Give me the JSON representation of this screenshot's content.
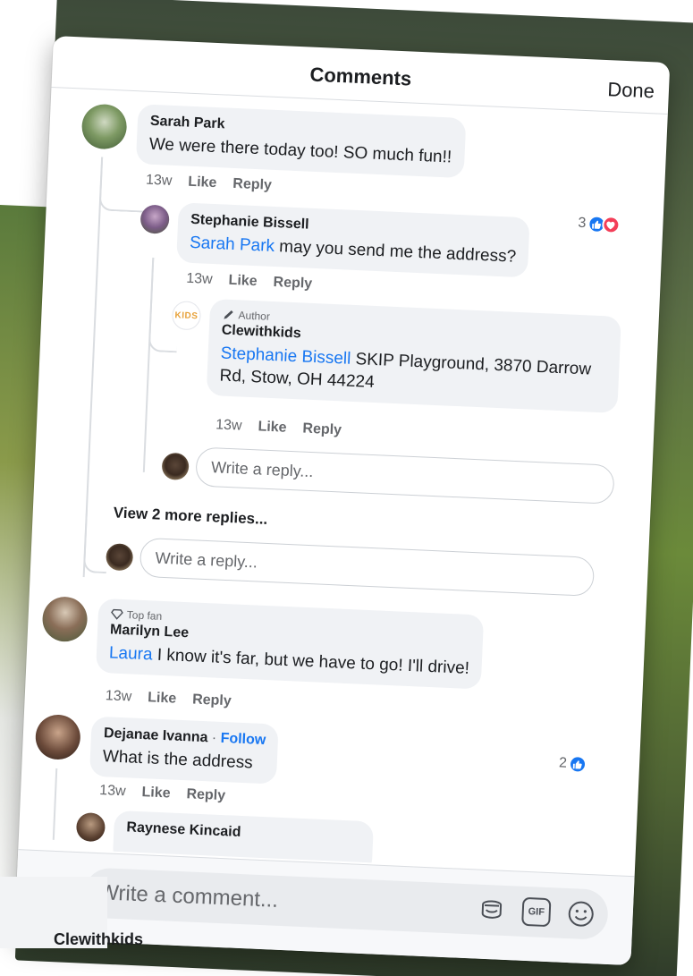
{
  "sheet": {
    "title": "Comments",
    "done_label": "Done"
  },
  "comments": [
    {
      "name": "Sarah Park",
      "text": "We were there today too!  SO much fun!!",
      "time": "13w",
      "like": "Like",
      "reply": "Reply",
      "reaction_count": "3",
      "reactions": [
        "like-icon",
        "love-icon"
      ]
    },
    {
      "name": "Stephanie Bissell",
      "mention": "Sarah Park",
      "text": " may you send me the address?",
      "time": "13w",
      "like": "Like",
      "reply": "Reply"
    },
    {
      "badge": "Author",
      "avatar_text": "KIDS",
      "name": "Clewithkids",
      "mention": "Stephanie Bissell",
      "text": " SKIP Playground, 3870 Darrow Rd, Stow, OH 44224",
      "time": "13w",
      "like": "Like",
      "reply": "Reply"
    },
    {
      "badge": "Top fan",
      "name": "Marilyn Lee",
      "mention": "Laura",
      "text": " I know it's far, but we have to go! I'll drive!",
      "time": "13w",
      "like": "Like",
      "reply": "Reply"
    },
    {
      "name": "Dejanae Ivanna",
      "follow": "Follow",
      "separator": " · ",
      "text": "What is the address",
      "time": "13w",
      "like": "Like",
      "reply": "Reply",
      "reaction_count": "2",
      "reactions": [
        "like-icon"
      ]
    },
    {
      "name": "Raynese Kincaid"
    }
  ],
  "reply_placeholder": "Write a reply...",
  "view_more": "View 2 more replies...",
  "composer": {
    "placeholder": "Write a comment...",
    "gif_label": "GIF"
  },
  "background": {
    "partial_name": "Clewithkids"
  },
  "colors": {
    "link": "#1877f2",
    "bubble": "#f0f2f5",
    "love": "#f33e58"
  }
}
